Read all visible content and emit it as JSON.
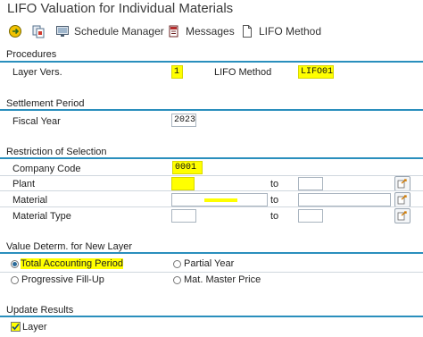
{
  "window": {
    "title": "LIFO Valuation for Individual Materials"
  },
  "toolbar": {
    "execute_icon": "execute-icon",
    "variant_icon": "variant-icon",
    "schedule_manager": "Schedule Manager",
    "messages": "Messages",
    "lifo_method": "LIFO Method"
  },
  "procedures": {
    "title": "Procedures",
    "layer_vers_label": "Layer Vers.",
    "layer_vers_value": "1",
    "lifo_method_label": "LIFO Method",
    "lifo_method_value": "LIFO01"
  },
  "settlement": {
    "title": "Settlement Period",
    "fiscal_year_label": "Fiscal Year",
    "fiscal_year_value": "2023"
  },
  "restriction": {
    "title": "Restriction of Selection",
    "company_code_label": "Company Code",
    "company_code_value": "0001",
    "to_label": "to",
    "rows": [
      {
        "label": "Plant",
        "from": "",
        "to": ""
      },
      {
        "label": "Material",
        "from": "",
        "to": ""
      },
      {
        "label": "Material Type",
        "from": "",
        "to": ""
      }
    ]
  },
  "value_determ": {
    "title": "Value Determ. for New Layer",
    "options": [
      {
        "label": "Total Accounting Period",
        "selected": true
      },
      {
        "label": "Partial Year",
        "selected": false
      },
      {
        "label": "Progressive Fill-Up",
        "selected": false
      },
      {
        "label": "Mat. Master Price",
        "selected": false
      }
    ]
  },
  "update_results": {
    "title": "Update Results",
    "layer_label": "Layer",
    "layer_checked": true
  },
  "colors": {
    "accent": "#2a8fbd",
    "highlight": "#ffff00"
  }
}
